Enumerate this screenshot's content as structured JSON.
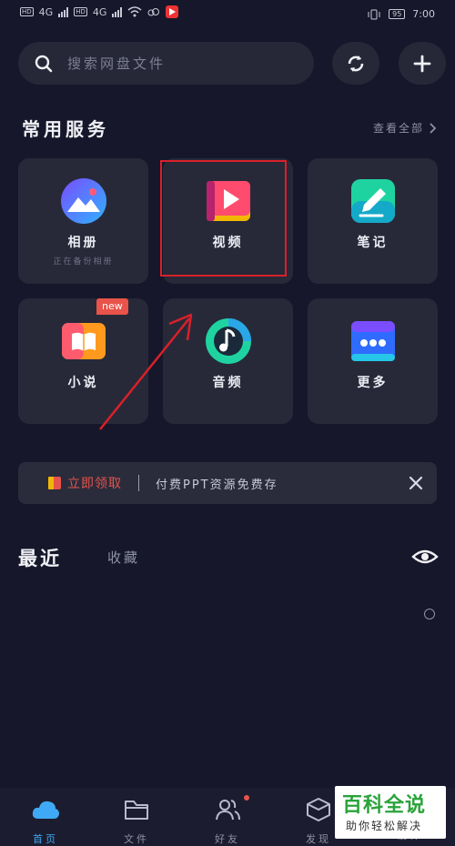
{
  "status_bar": {
    "left_labels": [
      "HD",
      "4G",
      "HD",
      "4G"
    ],
    "battery": "95",
    "time": "7:00"
  },
  "search": {
    "placeholder": "搜索网盘文件"
  },
  "services": {
    "title": "常用服务",
    "see_all": "查看全部",
    "items": [
      {
        "label": "相册",
        "sub": "正在备份相册",
        "icon": "photo-album-icon"
      },
      {
        "label": "视频",
        "sub": "",
        "icon": "video-play-icon"
      },
      {
        "label": "笔记",
        "sub": "",
        "icon": "note-pen-icon"
      },
      {
        "label": "小说",
        "sub": "",
        "icon": "book-icon",
        "badge": "new"
      },
      {
        "label": "音频",
        "sub": "",
        "icon": "music-note-icon"
      },
      {
        "label": "更多",
        "sub": "",
        "icon": "more-dots-icon"
      }
    ]
  },
  "promo": {
    "cta": "立即领取",
    "text": "付费PPT资源免费存"
  },
  "recent": {
    "tab_recent": "最近",
    "tab_favorites": "收藏"
  },
  "bottom_nav": [
    {
      "label": "首页",
      "icon": "cloud-home-icon",
      "active": true
    },
    {
      "label": "文件",
      "icon": "folder-icon",
      "active": false
    },
    {
      "label": "好友",
      "icon": "friends-icon",
      "active": false
    },
    {
      "label": "发现",
      "icon": "discover-cube-icon",
      "active": false
    },
    {
      "label": "设计",
      "icon": "",
      "active": false
    }
  ],
  "watermark": {
    "title": "百科全说",
    "subtitle": "助你轻松解决"
  },
  "colors": {
    "background": "#16172a",
    "card": "#272939",
    "accent_blue": "#3fa9f5",
    "highlight_red": "#d9202a",
    "promo_red": "#e5534b"
  }
}
